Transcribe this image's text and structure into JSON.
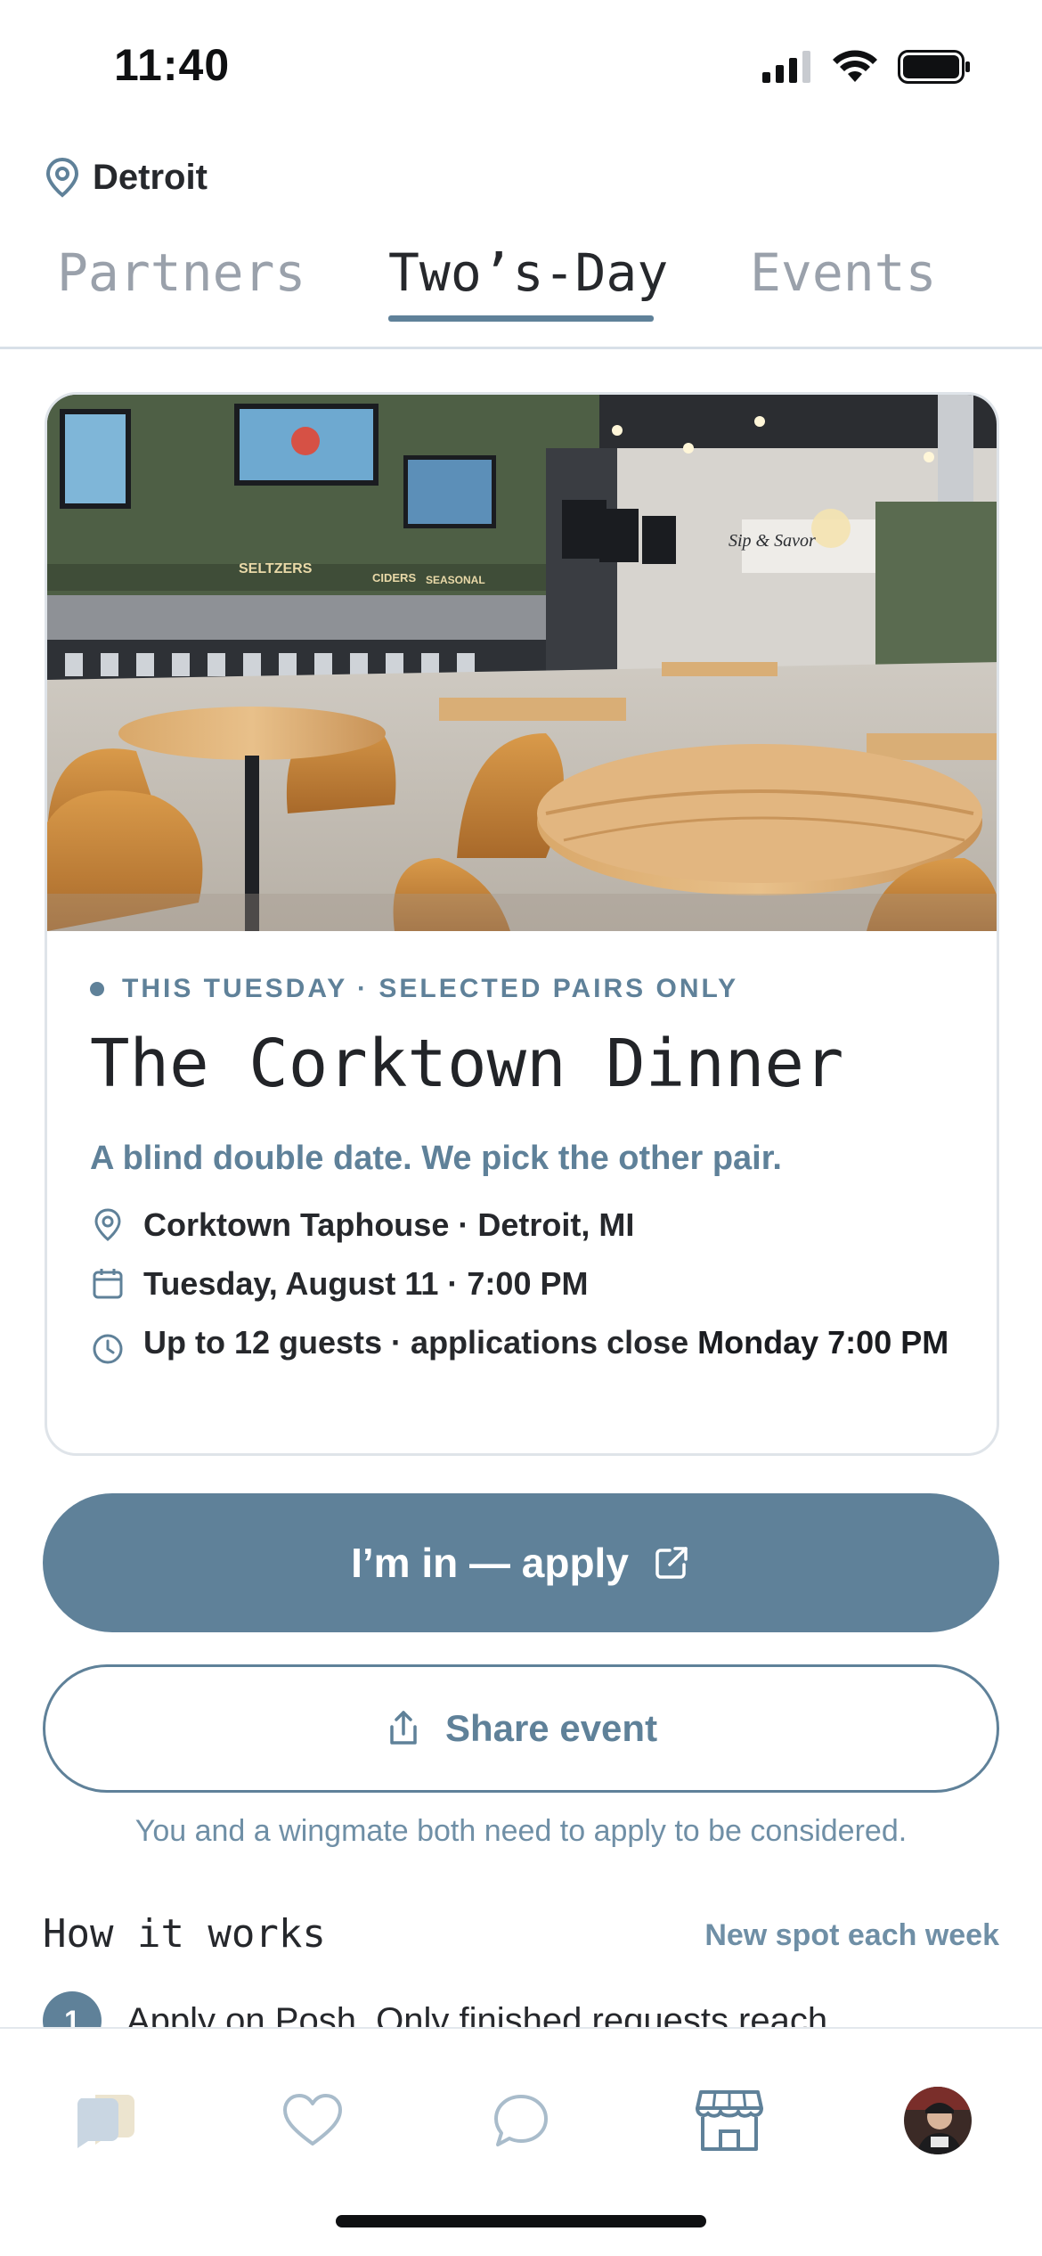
{
  "status_bar": {
    "time": "11:40"
  },
  "location": {
    "label": "Detroit"
  },
  "tabs": [
    {
      "label": "Partners",
      "active": false
    },
    {
      "label": "Two’s-Day",
      "active": true
    },
    {
      "label": "Events",
      "active": false
    }
  ],
  "hero": {
    "signage": {
      "seltzers": "SELTZERS",
      "ciders": "CIDERS",
      "seasonal": "SEASONAL",
      "brand": "Sip & Savor"
    }
  },
  "event": {
    "eyebrow": "THIS TUESDAY · SELECTED PAIRS ONLY",
    "title": "The Corktown Dinner",
    "subtitle": "A blind double date. We pick the other pair.",
    "location": "Corktown Taphouse · Detroit, MI",
    "datetime": "Tuesday, August 11 · 7:00 PM",
    "guests_prefix": "Up to 12 guests · applications close ",
    "guests_bold": "Monday 7:00 PM"
  },
  "actions": {
    "apply_label": "I’m in — apply",
    "share_label": "Share event",
    "helper": "You and a wingmate both need to apply to be considered."
  },
  "how_it_works": {
    "title": "How it works",
    "right_label": "New spot each week",
    "steps": [
      {
        "num": "1",
        "text": "Apply on Posh. Only finished requests reach"
      }
    ]
  },
  "colors": {
    "accent": "#5f8199",
    "text": "#26282c",
    "muted": "#9aa1ab"
  },
  "nav": {
    "items": [
      {
        "icon": "partners-icon"
      },
      {
        "icon": "heart-icon"
      },
      {
        "icon": "chat-icon"
      },
      {
        "icon": "storefront-icon",
        "active": true
      },
      {
        "icon": "avatar"
      }
    ]
  }
}
